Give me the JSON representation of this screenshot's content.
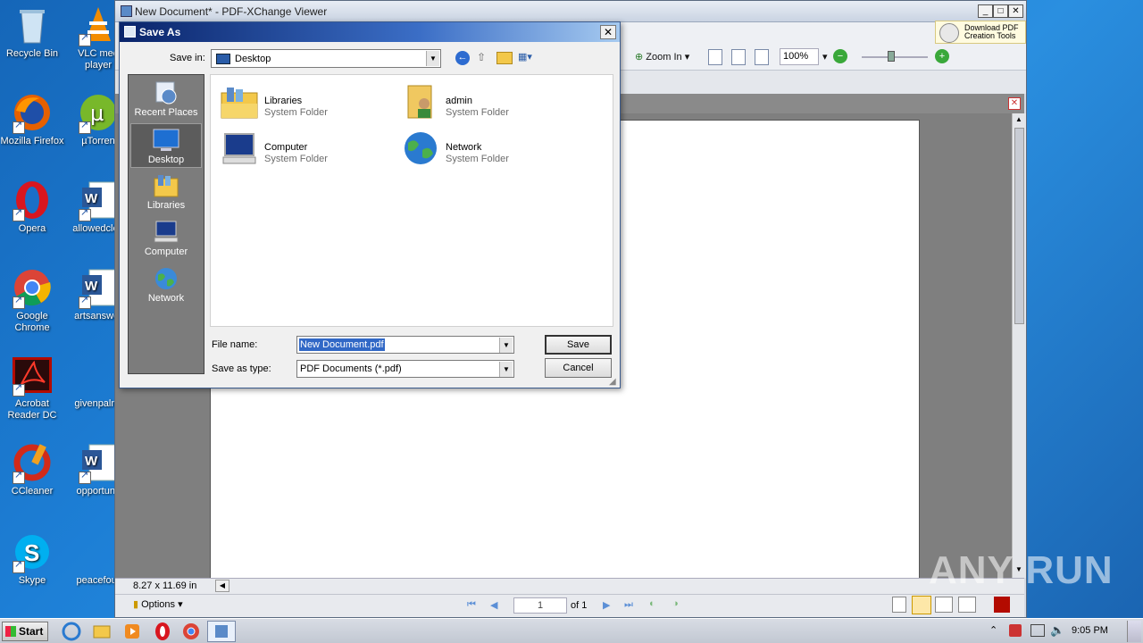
{
  "desktop": {
    "icons": [
      {
        "label": "Recycle Bin"
      },
      {
        "label": "VLC med\nplayer"
      },
      {
        "label": "Mozilla Firefox"
      },
      {
        "label": "µTorren"
      },
      {
        "label": "Opera"
      },
      {
        "label": "allowedclea"
      },
      {
        "label": "Google\nChrome"
      },
      {
        "label": "artsanswer"
      },
      {
        "label": "Acrobat\nReader DC"
      },
      {
        "label": "givenpalm."
      },
      {
        "label": "CCleaner"
      },
      {
        "label": "opportunit"
      },
      {
        "label": "Skype"
      },
      {
        "label": "peacefour"
      }
    ]
  },
  "viewer": {
    "title": "New Document* - PDF-XChange Viewer",
    "toolbar": {
      "zoom_in_label": "Zoom In",
      "zoom_value": "100%"
    },
    "promo": {
      "line1": "Download PDF",
      "line2": "Creation Tools"
    },
    "status": {
      "page_size": "8.27 x 11.69 in"
    },
    "nav": {
      "options_label": "Options",
      "current_page": "1",
      "of_pages": "of 1"
    }
  },
  "dialog": {
    "title": "Save As",
    "save_in_label": "Save in:",
    "save_in_value": "Desktop",
    "places": [
      {
        "label": "Recent Places"
      },
      {
        "label": "Desktop"
      },
      {
        "label": "Libraries"
      },
      {
        "label": "Computer"
      },
      {
        "label": "Network"
      }
    ],
    "files": [
      {
        "name": "Libraries",
        "type": "System Folder"
      },
      {
        "name": "admin",
        "type": "System Folder"
      },
      {
        "name": "Computer",
        "type": "System Folder"
      },
      {
        "name": "Network",
        "type": "System Folder"
      }
    ],
    "file_name_label": "File name:",
    "file_name_value": "New Document.pdf",
    "save_as_type_label": "Save as type:",
    "save_as_type_value": "PDF Documents (*.pdf)",
    "save_label": "Save",
    "cancel_label": "Cancel"
  },
  "taskbar": {
    "start_label": "Start",
    "clock": "9:05 PM"
  },
  "watermark": "ANY RUN",
  "colors": {
    "title_active": "#0a246a",
    "selection": "#3168c6",
    "desktop": "#1d7fd6"
  }
}
